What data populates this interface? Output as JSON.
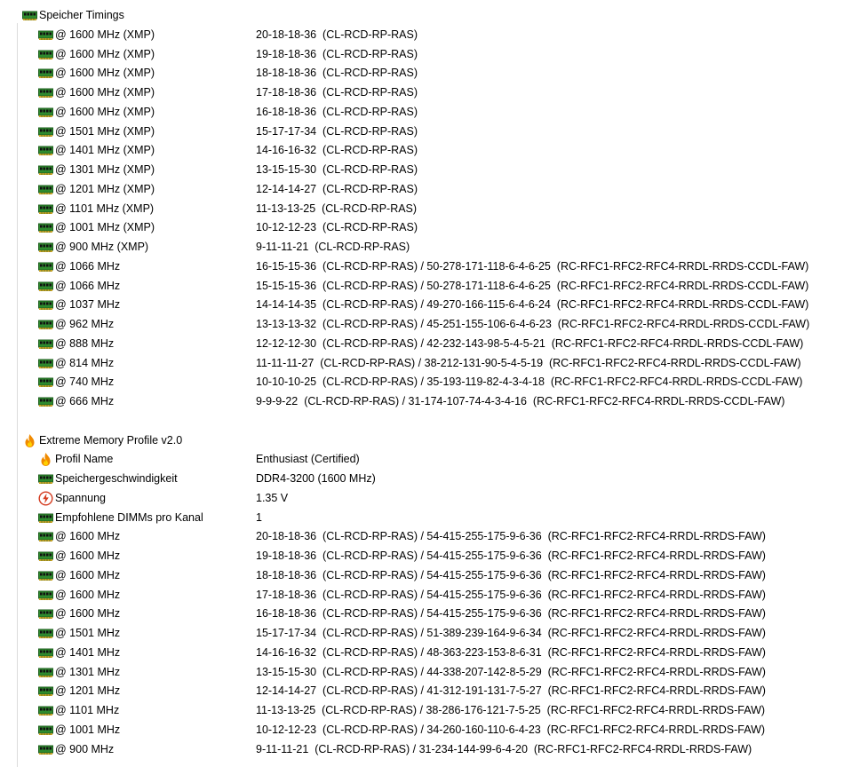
{
  "sections": [
    {
      "title": "Speicher Timings",
      "icon": "memory-module-icon",
      "rows": [
        {
          "label": "@ 1600 MHz (XMP)",
          "value": "20-18-18-36  (CL-RCD-RP-RAS)",
          "icon": "memory-module-icon"
        },
        {
          "label": "@ 1600 MHz (XMP)",
          "value": "19-18-18-36  (CL-RCD-RP-RAS)",
          "icon": "memory-module-icon"
        },
        {
          "label": "@ 1600 MHz (XMP)",
          "value": "18-18-18-36  (CL-RCD-RP-RAS)",
          "icon": "memory-module-icon"
        },
        {
          "label": "@ 1600 MHz (XMP)",
          "value": "17-18-18-36  (CL-RCD-RP-RAS)",
          "icon": "memory-module-icon"
        },
        {
          "label": "@ 1600 MHz (XMP)",
          "value": "16-18-18-36  (CL-RCD-RP-RAS)",
          "icon": "memory-module-icon"
        },
        {
          "label": "@ 1501 MHz (XMP)",
          "value": "15-17-17-34  (CL-RCD-RP-RAS)",
          "icon": "memory-module-icon"
        },
        {
          "label": "@ 1401 MHz (XMP)",
          "value": "14-16-16-32  (CL-RCD-RP-RAS)",
          "icon": "memory-module-icon"
        },
        {
          "label": "@ 1301 MHz (XMP)",
          "value": "13-15-15-30  (CL-RCD-RP-RAS)",
          "icon": "memory-module-icon"
        },
        {
          "label": "@ 1201 MHz (XMP)",
          "value": "12-14-14-27  (CL-RCD-RP-RAS)",
          "icon": "memory-module-icon"
        },
        {
          "label": "@ 1101 MHz (XMP)",
          "value": "11-13-13-25  (CL-RCD-RP-RAS)",
          "icon": "memory-module-icon"
        },
        {
          "label": "@ 1001 MHz (XMP)",
          "value": "10-12-12-23  (CL-RCD-RP-RAS)",
          "icon": "memory-module-icon"
        },
        {
          "label": "@ 900 MHz (XMP)",
          "value": "9-11-11-21  (CL-RCD-RP-RAS)",
          "icon": "memory-module-icon"
        },
        {
          "label": "@ 1066 MHz",
          "value": "16-15-15-36  (CL-RCD-RP-RAS) / 50-278-171-118-6-4-6-25  (RC-RFC1-RFC2-RFC4-RRDL-RRDS-CCDL-FAW)",
          "icon": "memory-module-icon"
        },
        {
          "label": "@ 1066 MHz",
          "value": "15-15-15-36  (CL-RCD-RP-RAS) / 50-278-171-118-6-4-6-25  (RC-RFC1-RFC2-RFC4-RRDL-RRDS-CCDL-FAW)",
          "icon": "memory-module-icon"
        },
        {
          "label": "@ 1037 MHz",
          "value": "14-14-14-35  (CL-RCD-RP-RAS) / 49-270-166-115-6-4-6-24  (RC-RFC1-RFC2-RFC4-RRDL-RRDS-CCDL-FAW)",
          "icon": "memory-module-icon"
        },
        {
          "label": "@ 962 MHz",
          "value": "13-13-13-32  (CL-RCD-RP-RAS) / 45-251-155-106-6-4-6-23  (RC-RFC1-RFC2-RFC4-RRDL-RRDS-CCDL-FAW)",
          "icon": "memory-module-icon"
        },
        {
          "label": "@ 888 MHz",
          "value": "12-12-12-30  (CL-RCD-RP-RAS) / 42-232-143-98-5-4-5-21  (RC-RFC1-RFC2-RFC4-RRDL-RRDS-CCDL-FAW)",
          "icon": "memory-module-icon"
        },
        {
          "label": "@ 814 MHz",
          "value": "11-11-11-27  (CL-RCD-RP-RAS) / 38-212-131-90-5-4-5-19  (RC-RFC1-RFC2-RFC4-RRDL-RRDS-CCDL-FAW)",
          "icon": "memory-module-icon"
        },
        {
          "label": "@ 740 MHz",
          "value": "10-10-10-25  (CL-RCD-RP-RAS) / 35-193-119-82-4-3-4-18  (RC-RFC1-RFC2-RFC4-RRDL-RRDS-CCDL-FAW)",
          "icon": "memory-module-icon"
        },
        {
          "label": "@ 666 MHz",
          "value": "9-9-9-22  (CL-RCD-RP-RAS) / 31-174-107-74-4-3-4-16  (RC-RFC1-RFC2-RFC4-RRDL-RRDS-CCDL-FAW)",
          "icon": "memory-module-icon"
        }
      ]
    },
    {
      "title": "Extreme Memory Profile v2.0",
      "icon": "flame-icon",
      "rows": [
        {
          "label": "Profil Name",
          "value": "Enthusiast (Certified)",
          "icon": "flame-icon"
        },
        {
          "label": "Speichergeschwindigkeit",
          "value": "DDR4-3200 (1600 MHz)",
          "icon": "memory-module-icon"
        },
        {
          "label": "Spannung",
          "value": "1.35 V",
          "icon": "voltage-icon"
        },
        {
          "label": "Empfohlene DIMMs pro Kanal",
          "value": "1",
          "icon": "memory-module-icon"
        },
        {
          "label": "@ 1600 MHz",
          "value": "20-18-18-36  (CL-RCD-RP-RAS) / 54-415-255-175-9-6-36  (RC-RFC1-RFC2-RFC4-RRDL-RRDS-FAW)",
          "icon": "memory-module-icon"
        },
        {
          "label": "@ 1600 MHz",
          "value": "19-18-18-36  (CL-RCD-RP-RAS) / 54-415-255-175-9-6-36  (RC-RFC1-RFC2-RFC4-RRDL-RRDS-FAW)",
          "icon": "memory-module-icon"
        },
        {
          "label": "@ 1600 MHz",
          "value": "18-18-18-36  (CL-RCD-RP-RAS) / 54-415-255-175-9-6-36  (RC-RFC1-RFC2-RFC4-RRDL-RRDS-FAW)",
          "icon": "memory-module-icon"
        },
        {
          "label": "@ 1600 MHz",
          "value": "17-18-18-36  (CL-RCD-RP-RAS) / 54-415-255-175-9-6-36  (RC-RFC1-RFC2-RFC4-RRDL-RRDS-FAW)",
          "icon": "memory-module-icon"
        },
        {
          "label": "@ 1600 MHz",
          "value": "16-18-18-36  (CL-RCD-RP-RAS) / 54-415-255-175-9-6-36  (RC-RFC1-RFC2-RFC4-RRDL-RRDS-FAW)",
          "icon": "memory-module-icon"
        },
        {
          "label": "@ 1501 MHz",
          "value": "15-17-17-34  (CL-RCD-RP-RAS) / 51-389-239-164-9-6-34  (RC-RFC1-RFC2-RFC4-RRDL-RRDS-FAW)",
          "icon": "memory-module-icon"
        },
        {
          "label": "@ 1401 MHz",
          "value": "14-16-16-32  (CL-RCD-RP-RAS) / 48-363-223-153-8-6-31  (RC-RFC1-RFC2-RFC4-RRDL-RRDS-FAW)",
          "icon": "memory-module-icon"
        },
        {
          "label": "@ 1301 MHz",
          "value": "13-15-15-30  (CL-RCD-RP-RAS) / 44-338-207-142-8-5-29  (RC-RFC1-RFC2-RFC4-RRDL-RRDS-FAW)",
          "icon": "memory-module-icon"
        },
        {
          "label": "@ 1201 MHz",
          "value": "12-14-14-27  (CL-RCD-RP-RAS) / 41-312-191-131-7-5-27  (RC-RFC1-RFC2-RFC4-RRDL-RRDS-FAW)",
          "icon": "memory-module-icon"
        },
        {
          "label": "@ 1101 MHz",
          "value": "11-13-13-25  (CL-RCD-RP-RAS) / 38-286-176-121-7-5-25  (RC-RFC1-RFC2-RFC4-RRDL-RRDS-FAW)",
          "icon": "memory-module-icon"
        },
        {
          "label": "@ 1001 MHz",
          "value": "10-12-12-23  (CL-RCD-RP-RAS) / 34-260-160-110-6-4-23  (RC-RFC1-RFC2-RFC4-RRDL-RRDS-FAW)",
          "icon": "memory-module-icon"
        },
        {
          "label": "@ 900 MHz",
          "value": "9-11-11-21  (CL-RCD-RP-RAS) / 31-234-144-99-6-4-20  (RC-RFC1-RFC2-RFC4-RRDL-RRDS-FAW)",
          "icon": "memory-module-icon"
        }
      ]
    }
  ],
  "colors": {
    "module_green": "#2e8b2e",
    "module_dark": "#1f5f1f",
    "module_contacts": "#c9a227",
    "flame_orange": "#f08a00",
    "flame_yellow": "#ffd200",
    "voltage_red": "#d43b1f",
    "tree_line": "#dcdcdc"
  }
}
